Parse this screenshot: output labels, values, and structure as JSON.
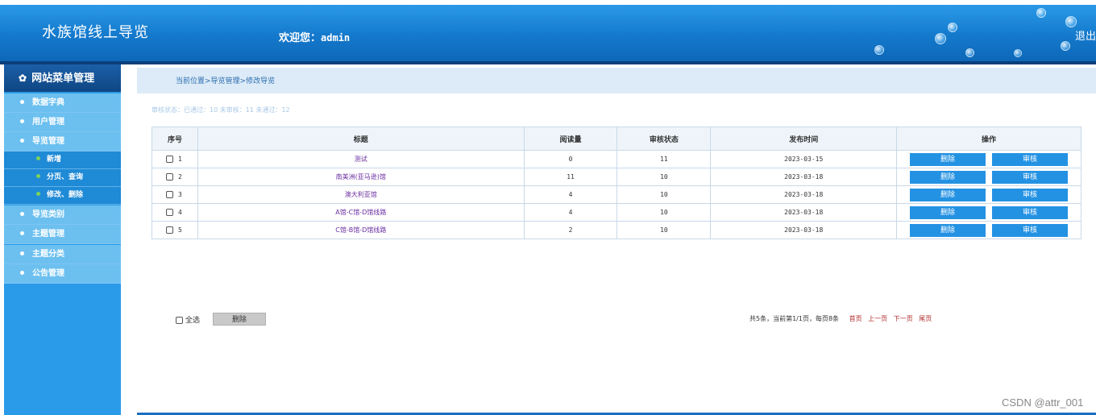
{
  "header": {
    "app_title": "水族馆线上导览",
    "welcome_prefix": "欢迎您：",
    "username": "admin",
    "logout_label": "退出"
  },
  "sidebar": {
    "title": "网站菜单管理",
    "items": [
      {
        "label": "数据字典",
        "level": 1
      },
      {
        "label": "用户管理",
        "level": 1
      },
      {
        "label": "导览管理",
        "level": 1
      },
      {
        "label": "新增",
        "level": 2
      },
      {
        "label": "分页、查询",
        "level": 2
      },
      {
        "label": "修改、删除",
        "level": 2
      },
      {
        "label": "导览类别",
        "level": 1
      },
      {
        "label": "主题管理",
        "level": 1
      },
      {
        "label": "主题分类",
        "level": 1
      },
      {
        "label": "公告管理",
        "level": 1
      }
    ]
  },
  "breadcrumb": {
    "text": "当前位置>导览管理>修改导览"
  },
  "status_note": "审核状态：已通过：10 未审核：11 未通过：12",
  "table": {
    "headers": [
      "序号",
      "标题",
      "阅读量",
      "审核状态",
      "发布时间",
      "操作"
    ],
    "rows": [
      {
        "idx": "1",
        "title": "测试",
        "reads": "0",
        "status": "11",
        "date": "2023-03-15"
      },
      {
        "idx": "2",
        "title": "南美洲(亚马逊)馆",
        "reads": "11",
        "status": "10",
        "date": "2023-03-18"
      },
      {
        "idx": "3",
        "title": "澳大利亚馆",
        "reads": "4",
        "status": "10",
        "date": "2023-03-18"
      },
      {
        "idx": "4",
        "title": "A馆-C馆-D馆线路",
        "reads": "4",
        "status": "10",
        "date": "2023-03-18"
      },
      {
        "idx": "5",
        "title": "C馆-B馆-D馆线路",
        "reads": "2",
        "status": "10",
        "date": "2023-03-18"
      }
    ],
    "delete_label": "删除",
    "audit_label": "审核"
  },
  "footer": {
    "select_all_label": "全选",
    "batch_delete_label": "删除",
    "pager_info": "共5条，当前第1/1页，每页8条",
    "first_label": "首页",
    "prev_label": "上一页",
    "next_label": "下一页",
    "last_label": "尾页"
  },
  "watermark": "CSDN @attr_001",
  "colors": {
    "header_blue": "#1479cc",
    "sidebar_blue": "#2a9be8",
    "button_blue": "#2492e3",
    "title_purple": "#6a2ea0"
  }
}
